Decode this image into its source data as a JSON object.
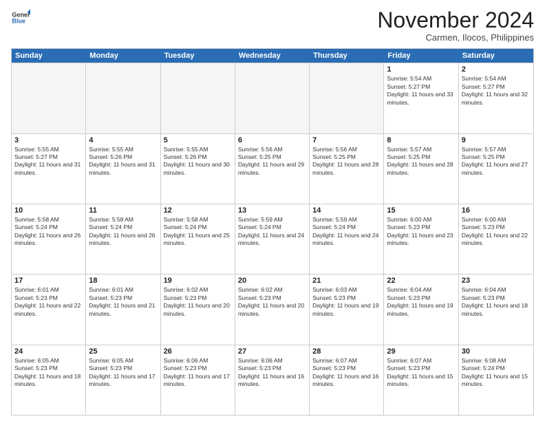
{
  "header": {
    "logo": {
      "general": "General",
      "blue": "Blue"
    },
    "month": "November 2024",
    "location": "Carmen, Ilocos, Philippines"
  },
  "days_of_week": [
    "Sunday",
    "Monday",
    "Tuesday",
    "Wednesday",
    "Thursday",
    "Friday",
    "Saturday"
  ],
  "weeks": [
    [
      {
        "day": "",
        "empty": true
      },
      {
        "day": "",
        "empty": true
      },
      {
        "day": "",
        "empty": true
      },
      {
        "day": "",
        "empty": true
      },
      {
        "day": "",
        "empty": true
      },
      {
        "day": "1",
        "sunrise": "5:54 AM",
        "sunset": "5:27 PM",
        "daylight": "11 hours and 33 minutes."
      },
      {
        "day": "2",
        "sunrise": "5:54 AM",
        "sunset": "5:27 PM",
        "daylight": "11 hours and 32 minutes."
      }
    ],
    [
      {
        "day": "3",
        "sunrise": "5:55 AM",
        "sunset": "5:27 PM",
        "daylight": "11 hours and 31 minutes."
      },
      {
        "day": "4",
        "sunrise": "5:55 AM",
        "sunset": "5:26 PM",
        "daylight": "11 hours and 31 minutes."
      },
      {
        "day": "5",
        "sunrise": "5:55 AM",
        "sunset": "5:26 PM",
        "daylight": "11 hours and 30 minutes."
      },
      {
        "day": "6",
        "sunrise": "5:56 AM",
        "sunset": "5:25 PM",
        "daylight": "11 hours and 29 minutes."
      },
      {
        "day": "7",
        "sunrise": "5:56 AM",
        "sunset": "5:25 PM",
        "daylight": "11 hours and 28 minutes."
      },
      {
        "day": "8",
        "sunrise": "5:57 AM",
        "sunset": "5:25 PM",
        "daylight": "11 hours and 28 minutes."
      },
      {
        "day": "9",
        "sunrise": "5:57 AM",
        "sunset": "5:25 PM",
        "daylight": "11 hours and 27 minutes."
      }
    ],
    [
      {
        "day": "10",
        "sunrise": "5:58 AM",
        "sunset": "5:24 PM",
        "daylight": "11 hours and 26 minutes."
      },
      {
        "day": "11",
        "sunrise": "5:58 AM",
        "sunset": "5:24 PM",
        "daylight": "11 hours and 26 minutes."
      },
      {
        "day": "12",
        "sunrise": "5:58 AM",
        "sunset": "5:24 PM",
        "daylight": "11 hours and 25 minutes."
      },
      {
        "day": "13",
        "sunrise": "5:59 AM",
        "sunset": "5:24 PM",
        "daylight": "11 hours and 24 minutes."
      },
      {
        "day": "14",
        "sunrise": "5:59 AM",
        "sunset": "5:24 PM",
        "daylight": "11 hours and 24 minutes."
      },
      {
        "day": "15",
        "sunrise": "6:00 AM",
        "sunset": "5:23 PM",
        "daylight": "11 hours and 23 minutes."
      },
      {
        "day": "16",
        "sunrise": "6:00 AM",
        "sunset": "5:23 PM",
        "daylight": "11 hours and 22 minutes."
      }
    ],
    [
      {
        "day": "17",
        "sunrise": "6:01 AM",
        "sunset": "5:23 PM",
        "daylight": "11 hours and 22 minutes."
      },
      {
        "day": "18",
        "sunrise": "6:01 AM",
        "sunset": "5:23 PM",
        "daylight": "11 hours and 21 minutes."
      },
      {
        "day": "19",
        "sunrise": "6:02 AM",
        "sunset": "5:23 PM",
        "daylight": "11 hours and 20 minutes."
      },
      {
        "day": "20",
        "sunrise": "6:02 AM",
        "sunset": "5:23 PM",
        "daylight": "11 hours and 20 minutes."
      },
      {
        "day": "21",
        "sunrise": "6:03 AM",
        "sunset": "5:23 PM",
        "daylight": "11 hours and 19 minutes."
      },
      {
        "day": "22",
        "sunrise": "6:04 AM",
        "sunset": "5:23 PM",
        "daylight": "11 hours and 19 minutes."
      },
      {
        "day": "23",
        "sunrise": "6:04 AM",
        "sunset": "5:23 PM",
        "daylight": "11 hours and 18 minutes."
      }
    ],
    [
      {
        "day": "24",
        "sunrise": "6:05 AM",
        "sunset": "5:23 PM",
        "daylight": "11 hours and 18 minutes."
      },
      {
        "day": "25",
        "sunrise": "6:05 AM",
        "sunset": "5:23 PM",
        "daylight": "11 hours and 17 minutes."
      },
      {
        "day": "26",
        "sunrise": "6:06 AM",
        "sunset": "5:23 PM",
        "daylight": "11 hours and 17 minutes."
      },
      {
        "day": "27",
        "sunrise": "6:06 AM",
        "sunset": "5:23 PM",
        "daylight": "11 hours and 16 minutes."
      },
      {
        "day": "28",
        "sunrise": "6:07 AM",
        "sunset": "5:23 PM",
        "daylight": "11 hours and 16 minutes."
      },
      {
        "day": "29",
        "sunrise": "6:07 AM",
        "sunset": "5:23 PM",
        "daylight": "11 hours and 15 minutes."
      },
      {
        "day": "30",
        "sunrise": "6:08 AM",
        "sunset": "5:24 PM",
        "daylight": "11 hours and 15 minutes."
      }
    ]
  ]
}
